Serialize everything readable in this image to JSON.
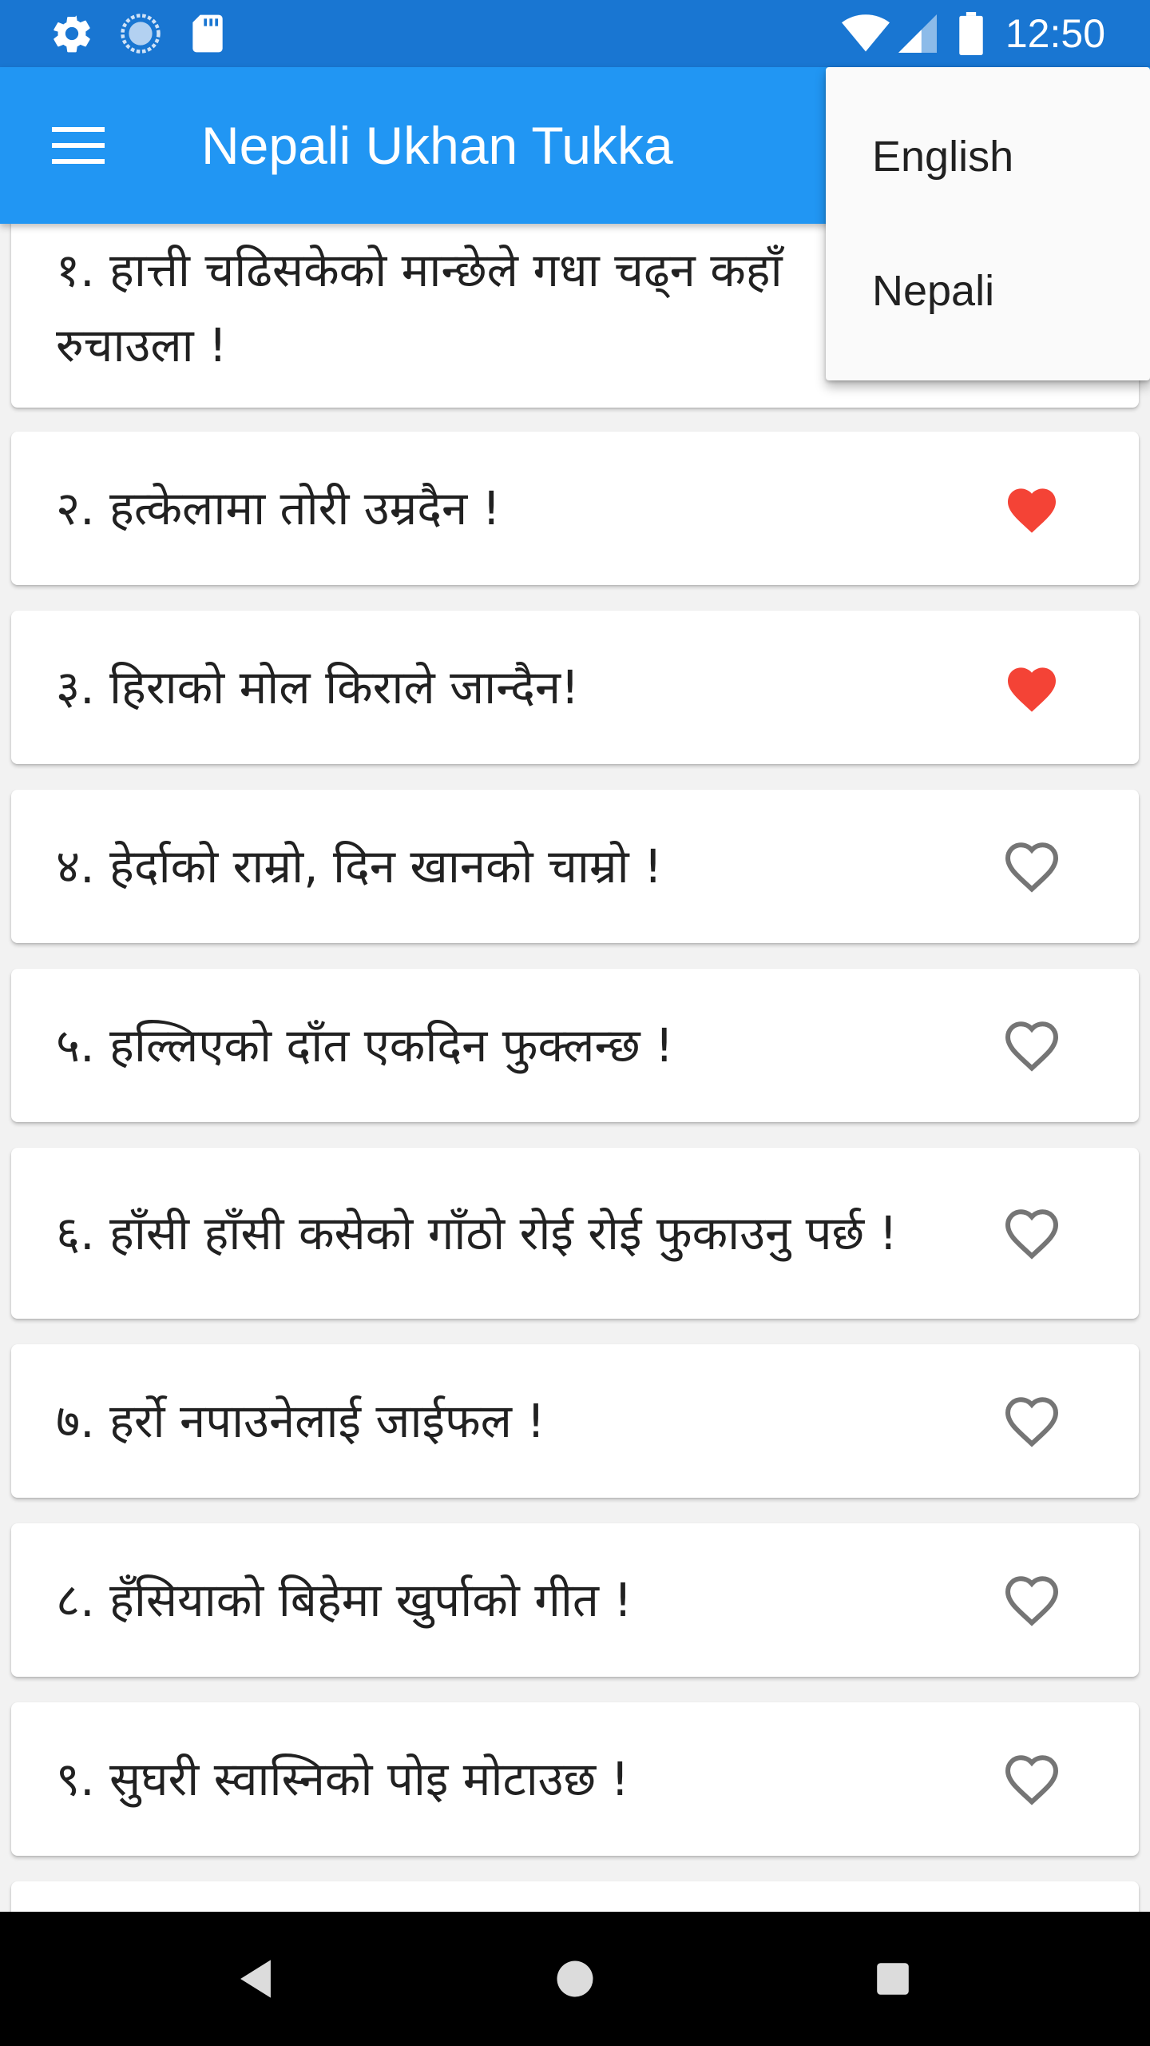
{
  "status_bar": {
    "time": "12:50",
    "left_icons": [
      "settings-icon",
      "sync-icon",
      "sd-card-icon"
    ],
    "right_icons": [
      "wifi-icon",
      "signal-icon",
      "battery-icon"
    ],
    "background": "#1976d2"
  },
  "app_bar": {
    "title": "Nepali Ukhan Tukka",
    "menu_icon": "hamburger-menu-icon",
    "background": "#2196f3"
  },
  "popup_menu": {
    "items": [
      {
        "label": "English"
      },
      {
        "label": "Nepali"
      }
    ]
  },
  "proverbs": [
    {
      "text": "१. हात्ती चढिसकेको मान्छेले गधा चढ्न कहाँ रुचाउला !",
      "favorite": false
    },
    {
      "text": "२. हत्केलामा तोरी उम्रदैन !",
      "favorite": true
    },
    {
      "text": "३. हिराको मोल किराले जान्दैन!",
      "favorite": true
    },
    {
      "text": "४. हेर्दाको राम्रो, दिन खानको चाम्रो !",
      "favorite": false
    },
    {
      "text": "५. हल्लिएको दाँत एकदिन फुक्लन्छ !",
      "favorite": false
    },
    {
      "text": "६. हाँसी हाँसी कसेको गाँठो रोई रोई फुकाउनु पर्छ !",
      "favorite": false
    },
    {
      "text": "७. हर्रो नपाउनेलाई जाईफल !",
      "favorite": false
    },
    {
      "text": "८. हँसियाको बिहेमा खुर्पाको गीत !",
      "favorite": false
    },
    {
      "text": "९. सुघरी स्वास्निको पोइ मोटाउछ !",
      "favorite": false
    }
  ],
  "colors": {
    "favorite_heart": "#f44336",
    "empty_heart": "#757575",
    "list_background": "#f2f2f2"
  },
  "nav_bar": {
    "buttons": [
      "back-icon",
      "home-icon",
      "recents-icon"
    ]
  }
}
